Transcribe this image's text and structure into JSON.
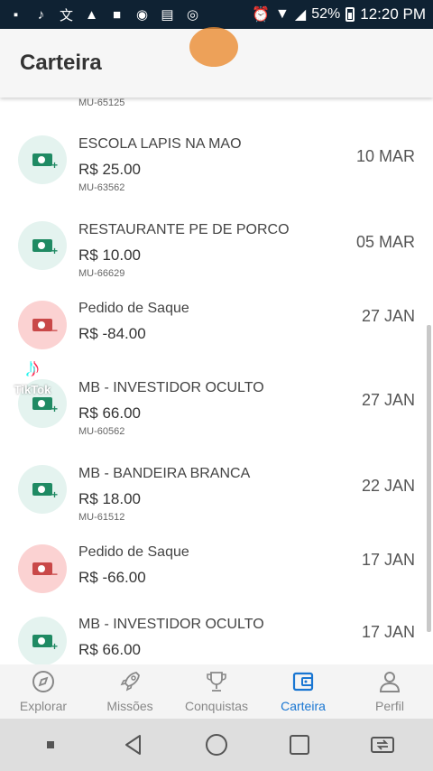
{
  "status_bar": {
    "notification_icons": [
      "app-icon",
      "tiktok-icon",
      "translate-icon",
      "warning-icon",
      "camera-icon",
      "coin-icon",
      "news-icon",
      "instagram-icon"
    ],
    "battery_percent": "52%",
    "time": "12:20 PM"
  },
  "header": {
    "title": "Carteira"
  },
  "partial_top_code": "MU-65125",
  "transactions": [
    {
      "type": "credit",
      "name": "ESCOLA LAPIS NA MAO",
      "amount": "R$ 25.00",
      "code": "MU-63562",
      "date": "10 MAR"
    },
    {
      "type": "credit",
      "name": "RESTAURANTE PE DE PORCO",
      "amount": "R$ 10.00",
      "code": "MU-66629",
      "date": "05 MAR"
    },
    {
      "type": "debit",
      "name": "Pedido de Saque",
      "amount": "R$ -84.00",
      "code": "",
      "date": "27 JAN"
    },
    {
      "type": "credit",
      "name": "MB - INVESTIDOR OCULTO",
      "amount": "R$ 66.00",
      "code": "MU-60562",
      "date": "27 JAN"
    },
    {
      "type": "credit",
      "name": "MB - BANDEIRA BRANCA",
      "amount": "R$ 18.00",
      "code": "MU-61512",
      "date": "22 JAN"
    },
    {
      "type": "debit",
      "name": "Pedido de Saque",
      "amount": "R$ -66.00",
      "code": "",
      "date": "17 JAN"
    },
    {
      "type": "credit",
      "name": "MB - INVESTIDOR OCULTO",
      "amount": "R$ 66.00",
      "code": "",
      "date": "17 JAN"
    }
  ],
  "watermark": "TikTok",
  "bottom_nav": [
    {
      "label": "Explorar",
      "icon": "compass-icon",
      "active": false
    },
    {
      "label": "Missões",
      "icon": "rocket-icon",
      "active": false
    },
    {
      "label": "Conquistas",
      "icon": "trophy-icon",
      "active": false
    },
    {
      "label": "Carteira",
      "icon": "wallet-icon",
      "active": true
    },
    {
      "label": "Perfil",
      "icon": "person-icon",
      "active": false
    }
  ],
  "colors": {
    "accent": "#1976d2",
    "credit": "#1f8a63",
    "debit": "#c94848",
    "status_bar": "#0f2233"
  }
}
